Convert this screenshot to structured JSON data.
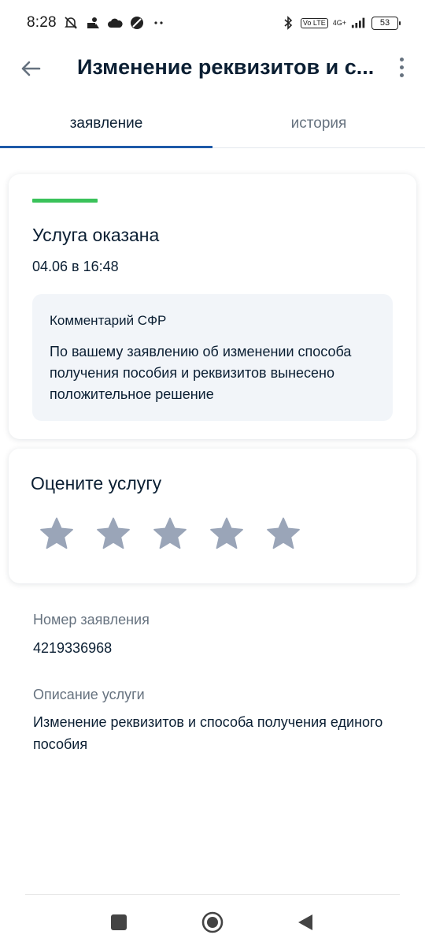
{
  "status_bar": {
    "time": "8:28",
    "battery": "53",
    "network_badge": "Vo LTE",
    "network_type": "4G+"
  },
  "app_bar": {
    "title": "Изменение реквизитов и с..."
  },
  "tabs": [
    {
      "label": "заявление",
      "active": true
    },
    {
      "label": "история",
      "active": false
    }
  ],
  "status_card": {
    "accent_color": "#3ac25a",
    "title": "Услуга оказана",
    "date": "04.06 в 16:48",
    "comment": {
      "title": "Комментарий СФР",
      "text": "По вашему заявлению об изменении способа получения пособия и реквизитов вынесено положительное решение"
    }
  },
  "rating": {
    "title": "Оцените услугу",
    "stars": 5,
    "selected": 0,
    "star_color": "#9aa5b8"
  },
  "details": {
    "number_label": "Номер заявления",
    "number_value": "4219336968",
    "description_label": "Описание услуги",
    "description_value": "Изменение реквизитов и способа получения единого пособия"
  },
  "colors": {
    "primary_text": "#0b1f33",
    "secondary_text": "#66727f",
    "tab_indicator": "#1e5aa8",
    "comment_bg": "#f2f5f9"
  }
}
